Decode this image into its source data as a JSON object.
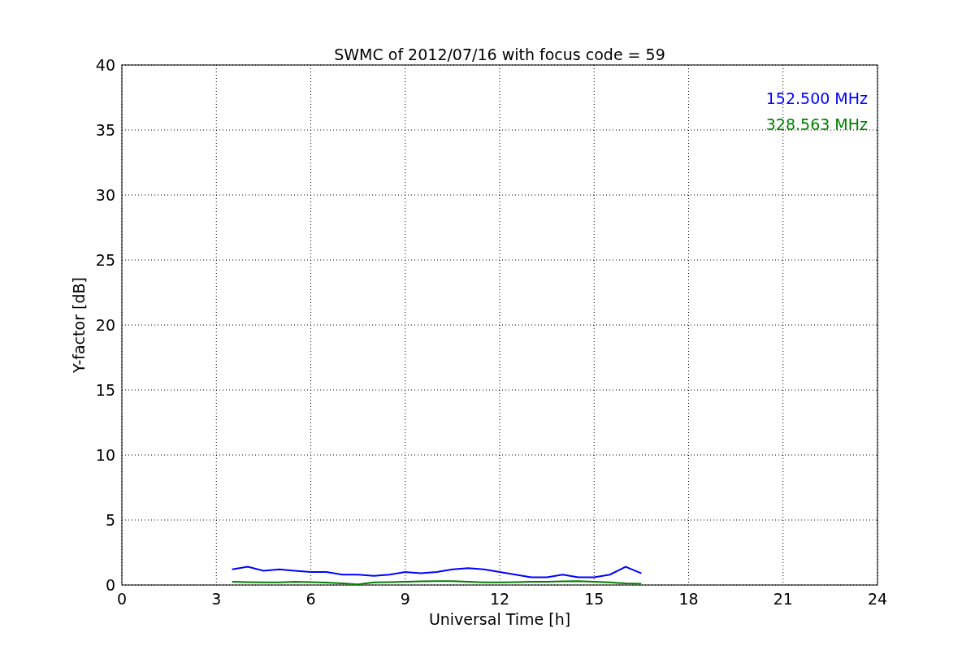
{
  "chart_data": {
    "type": "line",
    "title": "SWMC of 2012/07/16 with focus code = 59",
    "xlabel": "Universal Time [h]",
    "ylabel": "Y-factor [dB]",
    "x": [
      3.5,
      4,
      4.5,
      5,
      5.5,
      6,
      6.5,
      7,
      7.5,
      8,
      8.5,
      9,
      9.5,
      10,
      10.5,
      11,
      11.5,
      12,
      12.5,
      13,
      13.5,
      14,
      14.5,
      15,
      15.5,
      16,
      16.5
    ],
    "series": [
      {
        "name": "152.500 MHz",
        "color": "#0000ff",
        "values": [
          1.2,
          1.4,
          1.1,
          1.2,
          1.1,
          1.0,
          1.0,
          0.8,
          0.8,
          0.7,
          0.8,
          1.0,
          0.9,
          1.0,
          1.2,
          1.3,
          1.2,
          1.0,
          0.8,
          0.6,
          0.6,
          0.8,
          0.6,
          0.6,
          0.8,
          1.4,
          0.9
        ]
      },
      {
        "name": "328.563 MHz",
        "color": "#008000",
        "values": [
          0.25,
          0.22,
          0.2,
          0.2,
          0.25,
          0.22,
          0.18,
          0.12,
          0.05,
          0.2,
          0.22,
          0.25,
          0.28,
          0.3,
          0.3,
          0.25,
          0.2,
          0.2,
          0.22,
          0.25,
          0.25,
          0.28,
          0.3,
          0.25,
          0.2,
          0.12,
          0.1
        ]
      }
    ],
    "grid": true,
    "xlim": [
      0,
      24
    ],
    "ylim": [
      0,
      40
    ],
    "xticks": [
      0,
      3,
      6,
      9,
      12,
      15,
      18,
      21,
      24
    ],
    "yticks": [
      0,
      5,
      10,
      15,
      20,
      25,
      30,
      35,
      40
    ]
  }
}
